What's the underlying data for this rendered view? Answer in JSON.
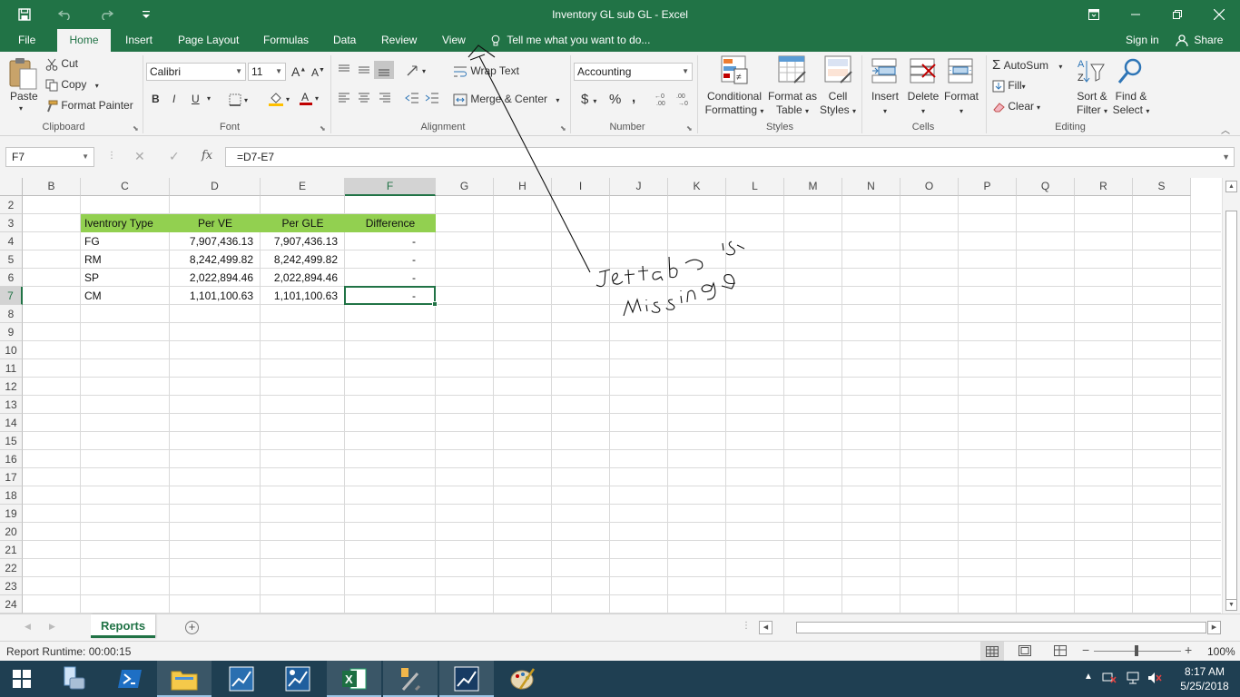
{
  "window": {
    "title": "Inventory GL sub GL - Excel"
  },
  "tabs": [
    "File",
    "Home",
    "Insert",
    "Page Layout",
    "Formulas",
    "Data",
    "Review",
    "View"
  ],
  "tell_me": "Tell me what you want to do...",
  "sign_in": "Sign in",
  "share": "Share",
  "ribbon": {
    "clipboard": {
      "label": "Clipboard",
      "paste": "Paste",
      "cut": "Cut",
      "copy": "Copy",
      "format_painter": "Format Painter"
    },
    "font": {
      "label": "Font",
      "name": "Calibri",
      "size": "11",
      "bold": "B",
      "italic": "I",
      "underline": "U"
    },
    "alignment": {
      "label": "Alignment",
      "wrap_text": "Wrap Text",
      "merge_center": "Merge & Center"
    },
    "number": {
      "label": "Number",
      "format": "Accounting",
      "currency": "$",
      "percent": "%",
      "comma": ","
    },
    "styles": {
      "label": "Styles",
      "conditional": "Conditional",
      "conditional2": "Formatting",
      "format_as": "Format as",
      "format_as2": "Table",
      "cell": "Cell",
      "cell2": "Styles"
    },
    "cells": {
      "label": "Cells",
      "insert": "Insert",
      "delete": "Delete",
      "format": "Format"
    },
    "editing": {
      "label": "Editing",
      "autosum": "AutoSum",
      "fill": "Fill",
      "clear": "Clear",
      "sort": "Sort &",
      "sort2": "Filter",
      "find": "Find &",
      "find2": "Select"
    }
  },
  "formula_bar": {
    "name_box": "F7",
    "fx": "fx",
    "formula": "=D7-E7"
  },
  "grid": {
    "columns": [
      "B",
      "C",
      "D",
      "E",
      "F",
      "G",
      "H",
      "I",
      "J",
      "K",
      "L",
      "M",
      "N",
      "O",
      "P",
      "Q",
      "R",
      "S"
    ],
    "rows": [
      "2",
      "3",
      "4",
      "5",
      "6",
      "7",
      "8",
      "9",
      "10",
      "11",
      "12",
      "13",
      "14",
      "15",
      "16",
      "17",
      "18",
      "19",
      "20",
      "21",
      "22",
      "23",
      "24"
    ],
    "selected_cell": "F7",
    "table": {
      "headers": [
        "Iventrory Type",
        "Per VE",
        "Per GLE",
        "Difference"
      ],
      "rows": [
        [
          "FG",
          "7,907,436.13",
          "7,907,436.13",
          "-"
        ],
        [
          "RM",
          "8,242,499.82",
          "8,242,499.82",
          "-"
        ],
        [
          "SP",
          "2,022,894.46",
          "2,022,894.46",
          "-"
        ],
        [
          "CM",
          "1,101,100.63",
          "1,101,100.63",
          "-"
        ]
      ]
    }
  },
  "sheet_tabs": [
    "Reports"
  ],
  "status": {
    "left": "Report Runtime:  00:00:15",
    "zoom": "100%"
  },
  "annotation": {
    "handwritten": "Jet tab is missing"
  },
  "taskbar": {
    "time": "8:17 AM",
    "date": "5/25/2018"
  }
}
